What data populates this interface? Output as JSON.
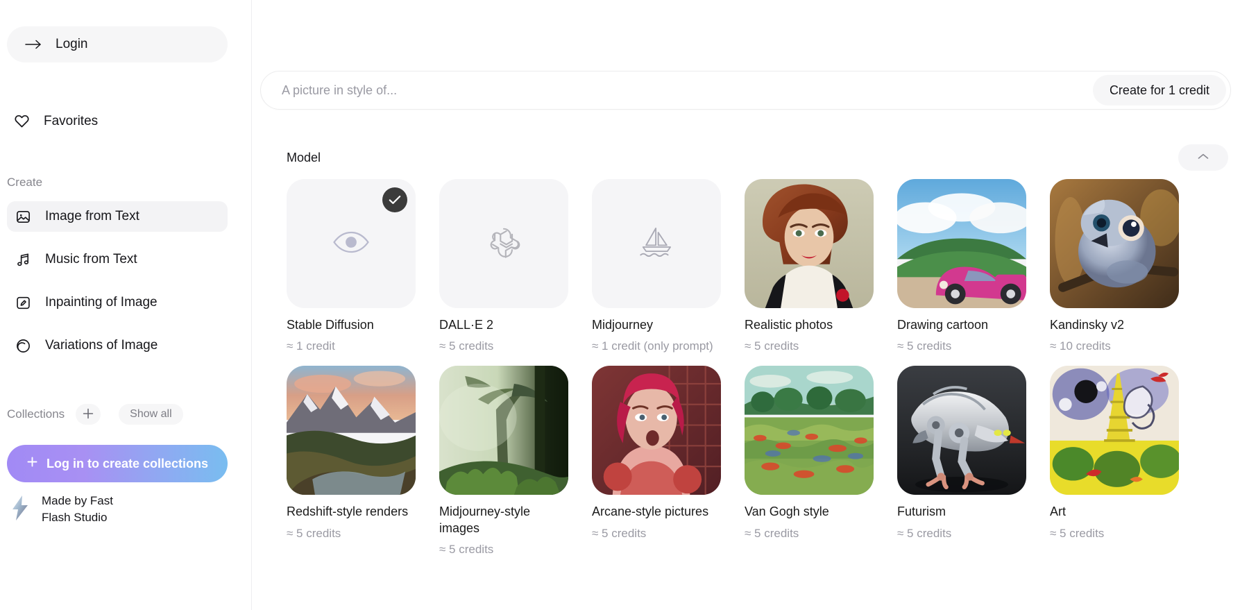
{
  "sidebar": {
    "login": {
      "label": "Login",
      "icon": "arrow-right-icon"
    },
    "favorites": {
      "label": "Favorites",
      "icon": "heart-icon"
    },
    "create_section_title": "Create",
    "nav_items": [
      {
        "label": "Image from Text",
        "icon": "image-icon",
        "active": true
      },
      {
        "label": "Music from Text",
        "icon": "music-note-icon",
        "active": false
      },
      {
        "label": "Inpainting of Image",
        "icon": "inpainting-icon",
        "active": false
      },
      {
        "label": "Variations of Image",
        "icon": "variations-icon",
        "active": false
      }
    ],
    "collections": {
      "title": "Collections",
      "add_label": "+",
      "show_all_label": "Show all",
      "login_cta_label": "Log in to create collections",
      "login_cta_plus": "+",
      "gradient_from": "#a18af5",
      "gradient_to": "#79bdf0"
    },
    "footer": {
      "line1": "Made by Fast",
      "line2": "Flash Studio",
      "icon": "lightning-bolt-icon"
    }
  },
  "main": {
    "prompt": {
      "placeholder": "A picture in style of...",
      "value": "",
      "create_button_label": "Create for 1 credit"
    },
    "model_section": {
      "title": "Model",
      "collapse_icon": "chevron-up-icon"
    },
    "models": [
      {
        "name": "Stable Diffusion",
        "credits": "≈ 1 credit",
        "art": "eye",
        "selected": true
      },
      {
        "name": "DALL·E 2",
        "credits": "≈ 5 credits",
        "art": "openai",
        "selected": false
      },
      {
        "name": "Midjourney",
        "credits": "≈ 1 credit (only prompt)",
        "art": "sailboat",
        "selected": false
      },
      {
        "name": "Realistic photos",
        "credits": "≈ 5 credits",
        "art": "portrait",
        "selected": false
      },
      {
        "name": "Drawing cartoon",
        "credits": "≈ 5 credits",
        "art": "car",
        "selected": false
      },
      {
        "name": "Kandinsky v2",
        "credits": "≈ 10 credits",
        "art": "bird",
        "selected": false
      },
      {
        "name": "Redshift-style renders",
        "credits": "≈ 5 credits",
        "art": "mountains",
        "selected": false
      },
      {
        "name": "Midjourney-style images",
        "credits": "≈ 5 credits",
        "art": "forest",
        "selected": false
      },
      {
        "name": "Arcane-style pictures",
        "credits": "≈ 5 credits",
        "art": "arcane",
        "selected": false
      },
      {
        "name": "Van Gogh style",
        "credits": "≈ 5 credits",
        "art": "vangogh",
        "selected": false
      },
      {
        "name": "Futurism",
        "credits": "≈ 5 credits",
        "art": "robot",
        "selected": false
      },
      {
        "name": "Art",
        "credits": "≈ 5 credits",
        "art": "abstract",
        "selected": false
      }
    ]
  }
}
